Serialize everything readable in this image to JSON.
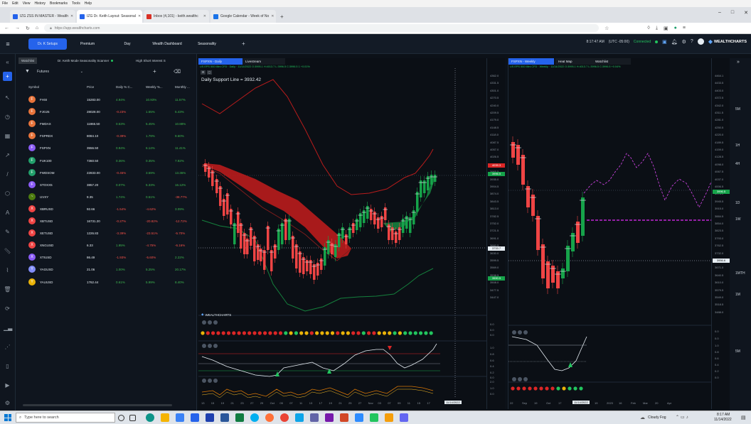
{
  "browser": {
    "menu": [
      "File",
      "Edit",
      "View",
      "History",
      "Bookmarks",
      "Tools",
      "Help"
    ],
    "tabs": [
      {
        "label": "IZG ZSS IN MASTER - Wealth",
        "color": "#2563eb",
        "active": false
      },
      {
        "label": "IZG Dr. Keith Layout: Seasonal",
        "color": "#2563eb",
        "active": true
      },
      {
        "label": "Inbox (4,101) - keith.wealthc",
        "color": "#d93025",
        "active": false
      },
      {
        "label": "Google Calendar - Week of No",
        "color": "#1a73e8",
        "active": false
      }
    ],
    "new_tab": "+",
    "url": "https://app.wealthcharts.com"
  },
  "app": {
    "nav": [
      {
        "label": "Dr. K Setups",
        "active": true
      },
      {
        "label": "Premium",
        "active": false
      },
      {
        "label": "Day",
        "active": false
      },
      {
        "label": "Wealth Dashboard",
        "active": false
      },
      {
        "label": "Seasonality",
        "active": false
      }
    ],
    "add": "+",
    "clock": "8:17:47 AM",
    "timezone": "(UTC -05:00)",
    "connection": "Connected",
    "brand": "WEALTHCHARTS",
    "status_color": "#22c55e"
  },
  "watchlist": {
    "tabs": [
      "Watchlist",
      "Dr. Keith Mode Seasonality Scanner",
      "High Short Interest S"
    ],
    "selector": "Futures",
    "columns": [
      "Symbol",
      "Price",
      "Daily % C...",
      "Weekly %...",
      "Monthly ..."
    ],
    "rows": [
      {
        "letter": "F",
        "color": "#e8743b",
        "symbol": "FHSI",
        "price": "15283.00",
        "daily": "4.94%",
        "weekly": "10.93%",
        "monthly": "11.57%",
        "dc": "#3fb950",
        "wc": "#3fb950",
        "mc": "#3fb950"
      },
      {
        "letter": "F",
        "color": "#e8743b",
        "symbol": "FJG25",
        "price": "28028.00",
        "daily": "-0.23%",
        "weekly": "1.55%",
        "monthly": "5.43%",
        "dc": "#f85149",
        "wc": "#3fb950",
        "mc": "#3fb950"
      },
      {
        "letter": "F",
        "color": "#e8743b",
        "symbol": "FMDAX",
        "price": "11865.50",
        "daily": "0.53%",
        "weekly": "5.45%",
        "monthly": "10.88%",
        "dc": "#3fb950",
        "wc": "#3fb950",
        "mc": "#3fb950"
      },
      {
        "letter": "F",
        "color": "#e8743b",
        "symbol": "FSPRDX",
        "price": "8084.10",
        "daily": "-0.39%",
        "weekly": "1.79%",
        "monthly": "9.60%",
        "dc": "#f85149",
        "wc": "#3fb950",
        "mc": "#3fb950"
      },
      {
        "letter": "F",
        "color": "#8b5cf6",
        "symbol": "FSPXN",
        "price": "3556.50",
        "daily": "0.94%",
        "weekly": "6.14%",
        "monthly": "11.41%",
        "dc": "#3fb950",
        "wc": "#3fb950",
        "mc": "#3fb950"
      },
      {
        "letter": "F",
        "color": "#22a06b",
        "symbol": "FUK100",
        "price": "7360.50",
        "daily": "0.36%",
        "weekly": "0.35%",
        "monthly": "7.92%",
        "dc": "#3fb950",
        "wc": "#3fb950",
        "mc": "#3fb950"
      },
      {
        "letter": "F",
        "color": "#22a06b",
        "symbol": "FWDSOM",
        "price": "22833.00",
        "daily": "-0.45%",
        "weekly": "3.59%",
        "monthly": "13.36%",
        "dc": "#f85149",
        "wc": "#3fb950",
        "mc": "#3fb950"
      },
      {
        "letter": "F",
        "color": "#8b5cf6",
        "symbol": "STOXX5",
        "price": "3857.20",
        "daily": "0.07%",
        "weekly": "5.33%",
        "monthly": "16.12%",
        "dc": "#3fb950",
        "wc": "#3fb950",
        "mc": "#3fb950"
      },
      {
        "letter": "~",
        "color": "#4d7c0f",
        "symbol": "UVXY",
        "price": "9.35",
        "daily": "1.74%",
        "weekly": "0.51%",
        "monthly": "-38.77%",
        "dc": "#3fb950",
        "wc": "#3fb950",
        "mc": "#f85149"
      },
      {
        "letter": "X",
        "color": "#ef4444",
        "symbol": "XBRUSD",
        "price": "92.66",
        "daily": "-1.54%",
        "weekly": "-4.62%",
        "monthly": "3.09%",
        "dc": "#f85149",
        "wc": "#f85149",
        "mc": "#3fb950"
      },
      {
        "letter": "X",
        "color": "#ef4444",
        "symbol": "XBTUSD",
        "price": "16731.20",
        "daily": "-0.27%",
        "weekly": "-20.82%",
        "monthly": "-12.72%",
        "dc": "#f85149",
        "wc": "#f85149",
        "mc": "#f85149"
      },
      {
        "letter": "X",
        "color": "#ef4444",
        "symbol": "XETUSD",
        "price": "1226.83",
        "daily": "-3.39%",
        "weekly": "-23.51%",
        "monthly": "-5.70%",
        "dc": "#f85149",
        "wc": "#f85149",
        "mc": "#f85149"
      },
      {
        "letter": "X",
        "color": "#ef4444",
        "symbol": "XNGUSD",
        "price": "6.33",
        "daily": "1.95%",
        "weekly": "-4.75%",
        "monthly": "-6.16%",
        "dc": "#3fb950",
        "wc": "#f85149",
        "mc": "#f85149"
      },
      {
        "letter": "X",
        "color": "#8b5cf6",
        "symbol": "XTIUSD",
        "price": "86.49",
        "daily": "-1.93%",
        "weekly": "-5.60%",
        "monthly": "2.22%",
        "dc": "#f85149",
        "wc": "#f85149",
        "mc": "#3fb950"
      },
      {
        "letter": "Y",
        "color": "#818cf8",
        "symbol": "YAGUSD",
        "price": "21.06",
        "daily": "1.00%",
        "weekly": "5.25%",
        "monthly": "20.17%",
        "dc": "#3fb950",
        "wc": "#3fb950",
        "mc": "#3fb950"
      },
      {
        "letter": "Y",
        "color": "#eab308",
        "symbol": "YAUUSD",
        "price": "1762.44",
        "daily": "0.61%",
        "weekly": "5.99%",
        "monthly": "8.40%",
        "dc": "#3fb950",
        "wc": "#3fb950",
        "mc": "#3fb950"
      }
    ]
  },
  "chart_left": {
    "tabs": [
      "FSPXN - Daily",
      "Livestream"
    ],
    "info": "US EPS 500 Mini CFD · Daily · 11/14/2022 O:3995.1 H:4013.7 L:3996.5 C:3996.5 1 +0.01%",
    "annotation": "Daily Support Line = 3932.42",
    "logo": "WEALTHCHARTS",
    "price_ticks": [
      "4362.0",
      "4331.5",
      "4301.0",
      "4270.5",
      "4240.0",
      "4209.5",
      "4179.0",
      "4148.5",
      "4118.0",
      "4087.5",
      "4057.0",
      "4026.5",
      "3996.0",
      "3965.5",
      "3935.0",
      "3904.5",
      "3874.0",
      "3843.5",
      "3813.0",
      "3782.5",
      "3752.0",
      "3721.5",
      "3691.0",
      "3660.5",
      "3630.0",
      "3599.5",
      "3569.0",
      "3538.5",
      "3508.0",
      "3477.5",
      "3447.0"
    ],
    "current_price": "3996.5",
    "tag1": "4039.3",
    "tag2": "3733.7",
    "tag3": "3590.5",
    "x_ticks": [
      "13",
      "15",
      "19",
      "21",
      "23",
      "27",
      "29",
      "Oct",
      "05",
      "07",
      "11",
      "13",
      "17",
      "19",
      "21",
      "25",
      "27",
      "Nov",
      "03",
      "07",
      "09",
      "11",
      "15",
      "17"
    ],
    "cursor_date": "11/14/2022",
    "osc_ticks": [
      "0.0",
      "0.0",
      "0.0",
      "1.0",
      "0.8",
      "0.6",
      "0.4",
      "0.2",
      "0.0",
      "2.0",
      "1.0",
      "0.0"
    ]
  },
  "chart_right": {
    "tabs": [
      "FSPXN - Weekly",
      "Heat Map",
      "Watchlist"
    ],
    "info": "US EPS 500 Mini CFD · Weekly · 11/14/2022 O:3995.1 H:4013.7 L:3996.5 C:3996.5 +0.04%",
    "price_ticks": [
      "4464.1",
      "4433.5",
      "4403.0",
      "4372.5",
      "4342.0",
      "4311.5",
      "4281.0",
      "4250.5",
      "4220.0",
      "4189.5",
      "4159.0",
      "4128.5",
      "4098.0",
      "4067.5",
      "4037.0",
      "4006.5",
      "3976.0",
      "3945.5",
      "3915.0",
      "3884.5",
      "3854.0",
      "3823.5",
      "3793.0",
      "3762.5",
      "3732.0",
      "3701.5",
      "3671.0",
      "3640.5",
      "3610.0",
      "3579.5",
      "3549.0",
      "3518.5",
      "3488.0"
    ],
    "current_price": "3996.5",
    "tag2": "3956.6",
    "x_ticks": [
      "22",
      "Sep",
      "19",
      "Oct",
      "17",
      "",
      "Dec",
      "19",
      "2023",
      "16",
      "Feb",
      "Mar",
      "20",
      "Apr"
    ],
    "cursor_date": "11/14/2022",
    "osc_ticks": [
      "0.0",
      "0.0",
      "1.0",
      "0.8",
      "0.6",
      "0.4",
      "0.2",
      "0.0"
    ]
  },
  "timeframes": [
    "5M",
    "1H",
    "4H",
    "1D",
    "1W",
    "1MTH",
    "1M",
    "5M"
  ],
  "taskbar": {
    "search": "Type here to search",
    "weather": "Cloudy Fog",
    "time": "8:17 AM",
    "date": "11/14/2022"
  }
}
